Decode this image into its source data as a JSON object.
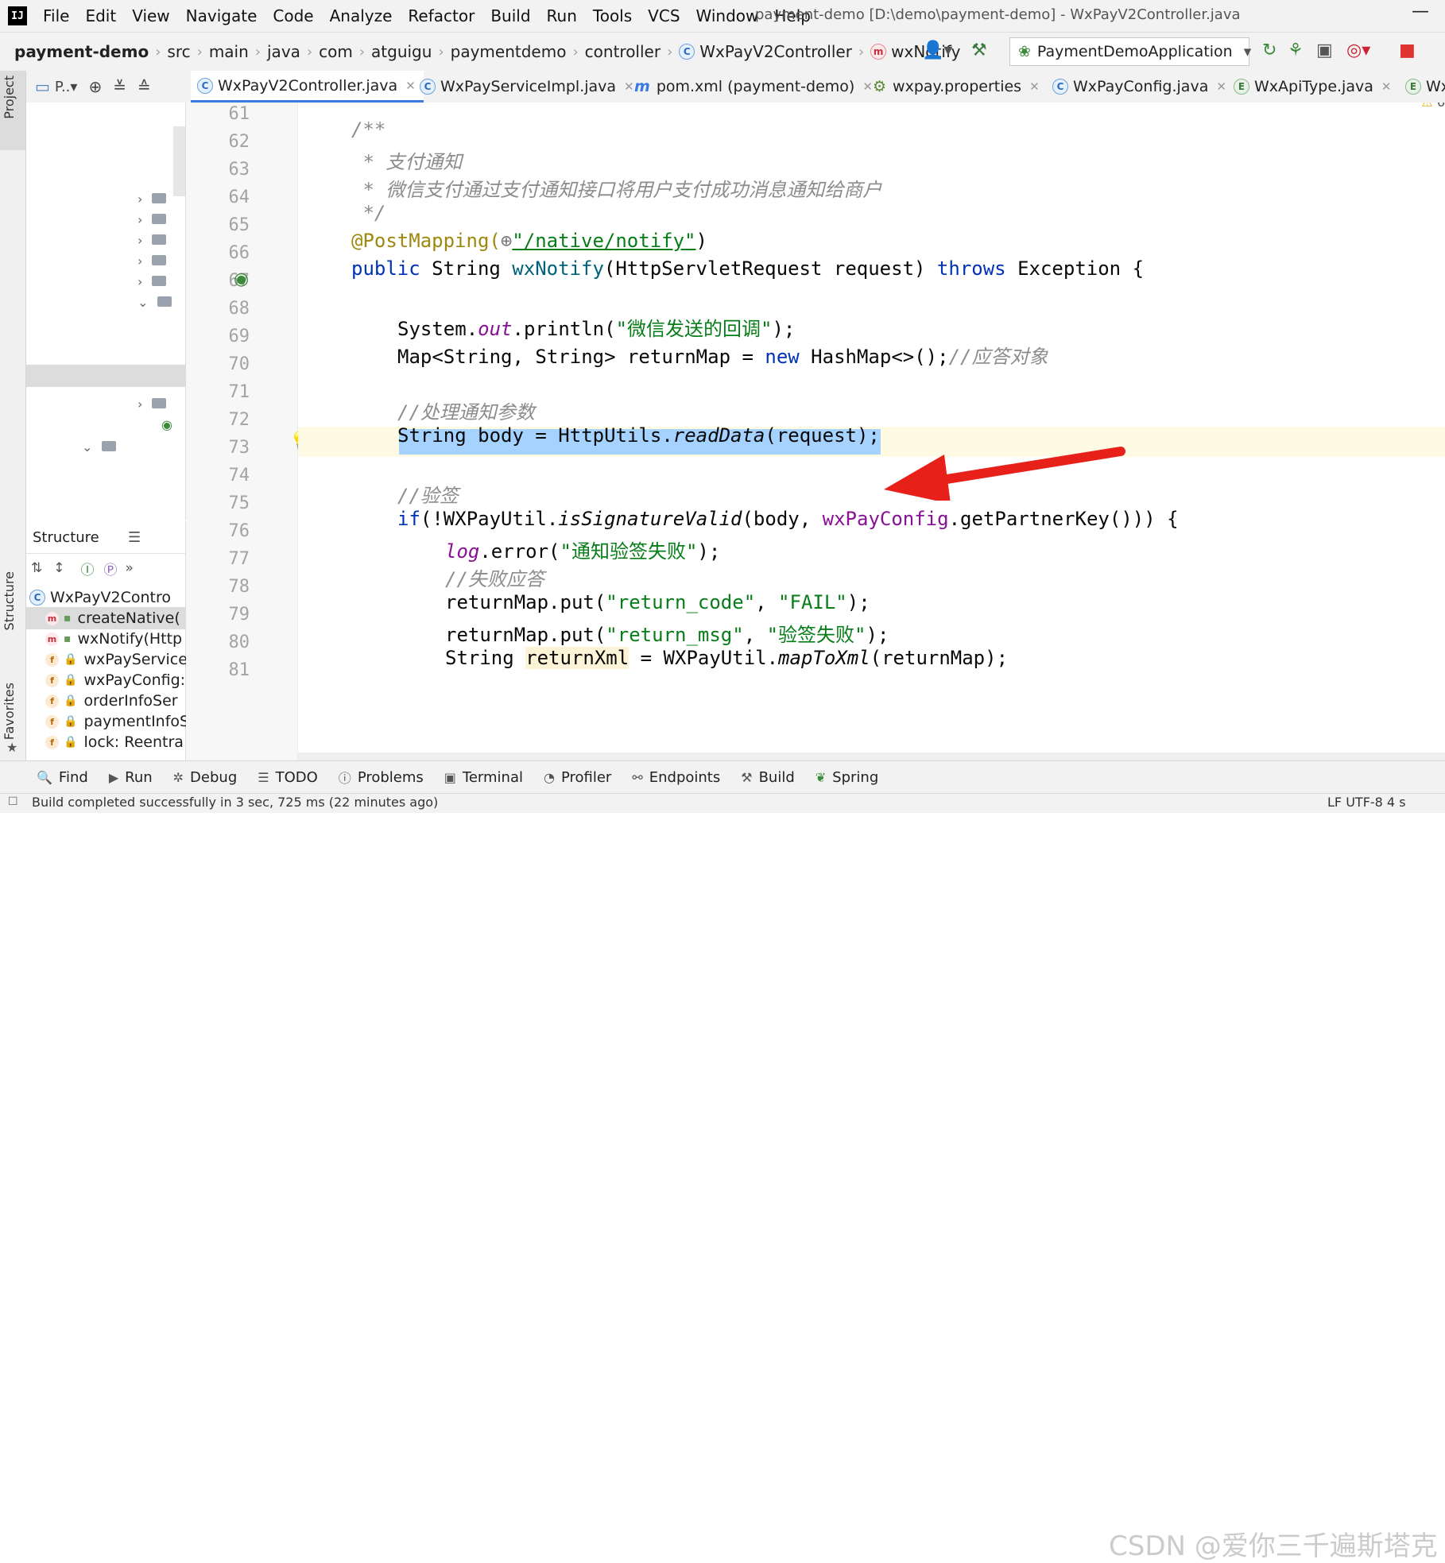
{
  "menu": {
    "logo": "IJ",
    "items": [
      "File",
      "Edit",
      "View",
      "Navigate",
      "Code",
      "Analyze",
      "Refactor",
      "Build",
      "Run",
      "Tools",
      "VCS",
      "Window",
      "Help"
    ],
    "window_title": "payment-demo [D:\\demo\\payment-demo] - WxPayV2Controller.java",
    "minimize": "—"
  },
  "breadcrumb": [
    "payment-demo",
    "src",
    "main",
    "java",
    "com",
    "atguigu",
    "paymentdemo",
    "controller",
    "WxPayV2Controller",
    "wxNotify"
  ],
  "run_config": "PaymentDemoApplication",
  "tabs": [
    {
      "label": "WxPayV2Controller.java",
      "icon": "C"
    },
    {
      "label": "WxPayServiceImpl.java",
      "icon": "C"
    },
    {
      "label": "pom.xml (payment-demo)",
      "icon": "m"
    },
    {
      "label": "wxpay.properties",
      "icon": "⚙"
    },
    {
      "label": "WxPayConfig.java",
      "icon": "C"
    },
    {
      "label": "WxApiType.java",
      "icon": "E"
    },
    {
      "label": "Wx",
      "icon": "E"
    }
  ],
  "project_pane": {
    "title": "P..▾"
  },
  "left_stripe": {
    "project": "Project",
    "structure": "Structure",
    "favorites": "Favorites"
  },
  "structure": {
    "title": "Structure",
    "class_name": "WxPayV2Contro",
    "members": [
      {
        "kind": "m",
        "name": "createNative("
      },
      {
        "kind": "m",
        "name": "wxNotify(Http"
      },
      {
        "kind": "f",
        "name": "wxPayService"
      },
      {
        "kind": "f",
        "name": "wxPayConfig:"
      },
      {
        "kind": "f",
        "name": "orderInfoSer"
      },
      {
        "kind": "f",
        "name": "paymentInfoS"
      },
      {
        "kind": "f",
        "name": "lock: Reentra"
      }
    ]
  },
  "line_numbers": [
    "61",
    "62",
    "63",
    "64",
    "65",
    "66",
    "67",
    "68",
    "69",
    "70",
    "71",
    "72",
    "73",
    "74",
    "75",
    "76",
    "77",
    "78",
    "79",
    "80",
    "81"
  ],
  "code": {
    "l62": "/**",
    "l63": " * 支付通知",
    "l64": " * 微信支付通过支付通知接口将用户支付成功消息通知给商户",
    "l65": " */",
    "l66_ann": "@PostMapping(",
    "l66_globe": "⊕",
    "l66_str": "\"/native/notify\"",
    "l66_end": ")",
    "l67_a": "public",
    "l67_b": " String ",
    "l67_c": "wxNotify",
    "l67_d": "(HttpServletRequest request) ",
    "l67_e": "throws",
    "l67_f": " Exception {",
    "l69_a": "System.",
    "l69_b": "out",
    "l69_c": ".println(",
    "l69_d": "\"微信发送的回调\"",
    "l69_e": ");",
    "l70_a": "Map<String, String> returnMap = ",
    "l70_b": "new",
    "l70_c": " HashMap<>();",
    "l70_d": "//应答对象",
    "l72": "//处理通知参数",
    "l73_a": "String body = HttpUtils.",
    "l73_b": "readData",
    "l73_c": "(request);",
    "l75": "//验签",
    "l76_a": "if",
    "l76_b": "(!WXPayUtil.",
    "l76_c": "isSignatureValid",
    "l76_d": "(body, ",
    "l76_e": "wxPayConfig",
    "l76_f": ".getPartnerKey())) {",
    "l77_a": "log",
    "l77_b": ".error(",
    "l77_c": "\"通知验签失败\"",
    "l77_d": ");",
    "l78": "//失败应答",
    "l79_a": "returnMap.put(",
    "l79_b": "\"return_code\"",
    "l79_c": ", ",
    "l79_d": "\"FAIL\"",
    "l79_e": ");",
    "l80_a": "returnMap.put(",
    "l80_b": "\"return_msg\"",
    "l80_c": ", ",
    "l80_d": "\"验签失败\"",
    "l80_e": ");",
    "l81_a": "String ",
    "l81_b": "returnXml",
    "l81_c": " = WXPayUtil.",
    "l81_d": "mapToXml",
    "l81_e": "(returnMap);"
  },
  "warnings": "6",
  "bottom_tools": [
    "Find",
    "Run",
    "Debug",
    "TODO",
    "Problems",
    "Terminal",
    "Profiler",
    "Endpoints",
    "Build",
    "Spring"
  ],
  "status": "Build completed successfully in 3 sec, 725 ms (22 minutes ago)",
  "status_right": "LF  UTF-8  4 s",
  "watermark": "CSDN @爱你三千遍斯塔克",
  "colors": {
    "accent": "#3b7be0",
    "selection": "#a6d2ff",
    "arrow": "#e8201a",
    "keyword": "#0033b3",
    "string": "#067d17",
    "comment": "#8c8c8c"
  }
}
